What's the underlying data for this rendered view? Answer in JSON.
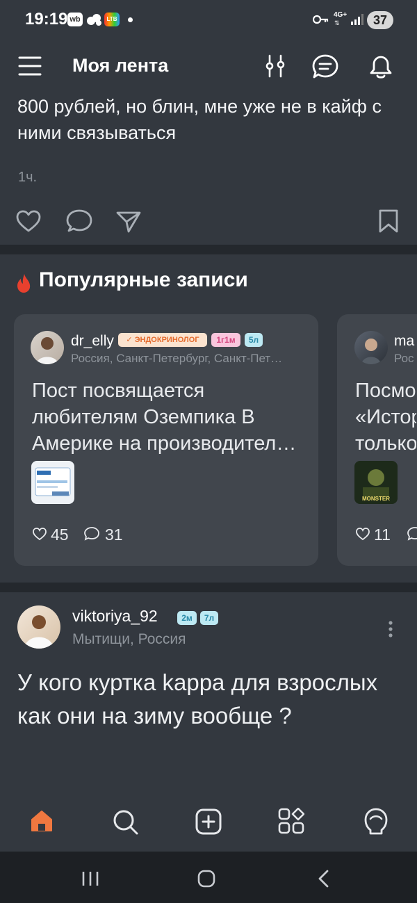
{
  "status_bar": {
    "time": "19:19",
    "badge_wb": "wb",
    "badge_ltb": "LTB",
    "network": "4G+",
    "battery": "37"
  },
  "header": {
    "title": "Моя лента"
  },
  "post_top": {
    "text": "800 рублей, но блин, мне уже не в кайф с ними связываться",
    "time": "1ч."
  },
  "popular": {
    "title": "Популярные записи",
    "cards": [
      {
        "username": "dr_elly",
        "badge_role": "✓ ЭНДОКРИНОЛОГ",
        "badge_age": "1г1м",
        "badge_kid": "5л",
        "location": "Россия, Санкт-Петербург, Санкт-Пет…",
        "text": "Пост посвящается любителям Оземпика  В Америке на производител…",
        "likes": "45",
        "comments": "31"
      },
      {
        "username": "ma",
        "location": "Рос",
        "text": "Посмо «Истор только",
        "thumb_label": "MONSTER",
        "likes": "11"
      }
    ]
  },
  "post2": {
    "username": "viktoriya_92",
    "badge1": "2м",
    "badge2": "7л",
    "location": "Мытищи, Россия",
    "text": "У кого куртка kappa для взрослых как они на зиму вообще ?"
  },
  "colors": {
    "background": "#33383f",
    "card": "#41464d",
    "accent_orange": "#f07840",
    "fire": "#e8402e"
  }
}
